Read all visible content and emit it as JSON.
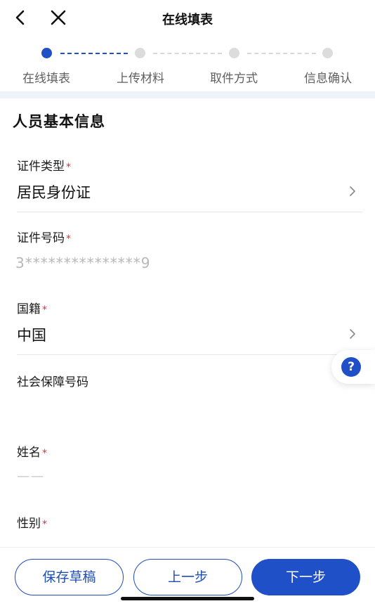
{
  "header": {
    "title": "在线填表",
    "back_icon": "chevron-left-icon",
    "close_icon": "close-icon"
  },
  "stepper": {
    "current_step": 1,
    "steps": [
      {
        "label": "在线填表",
        "active": true
      },
      {
        "label": "上传材料",
        "active": false
      },
      {
        "label": "取件方式",
        "active": false
      },
      {
        "label": "信息确认",
        "active": false
      }
    ]
  },
  "section": {
    "title": "人员基本信息"
  },
  "fields": {
    "id_type": {
      "label": "证件类型",
      "required": "*",
      "value": "居民身份证"
    },
    "id_number": {
      "label": "证件号码",
      "required": "*",
      "value": "3***************9"
    },
    "nationality": {
      "label": "国籍",
      "required": "*",
      "value": "中国"
    },
    "social_security": {
      "label": "社会保障号码",
      "value": ""
    },
    "name": {
      "label": "姓名",
      "required": "*",
      "value": "——"
    },
    "gender": {
      "label": "性别",
      "required": "*"
    }
  },
  "help": {
    "icon": "question-icon",
    "glyph": "?"
  },
  "footer": {
    "save_draft": "保存草稿",
    "prev_step": "上一步",
    "next_step": "下一步"
  },
  "colors": {
    "accent": "#2050c8",
    "required": "#e03030",
    "band": "#eef3f9"
  }
}
